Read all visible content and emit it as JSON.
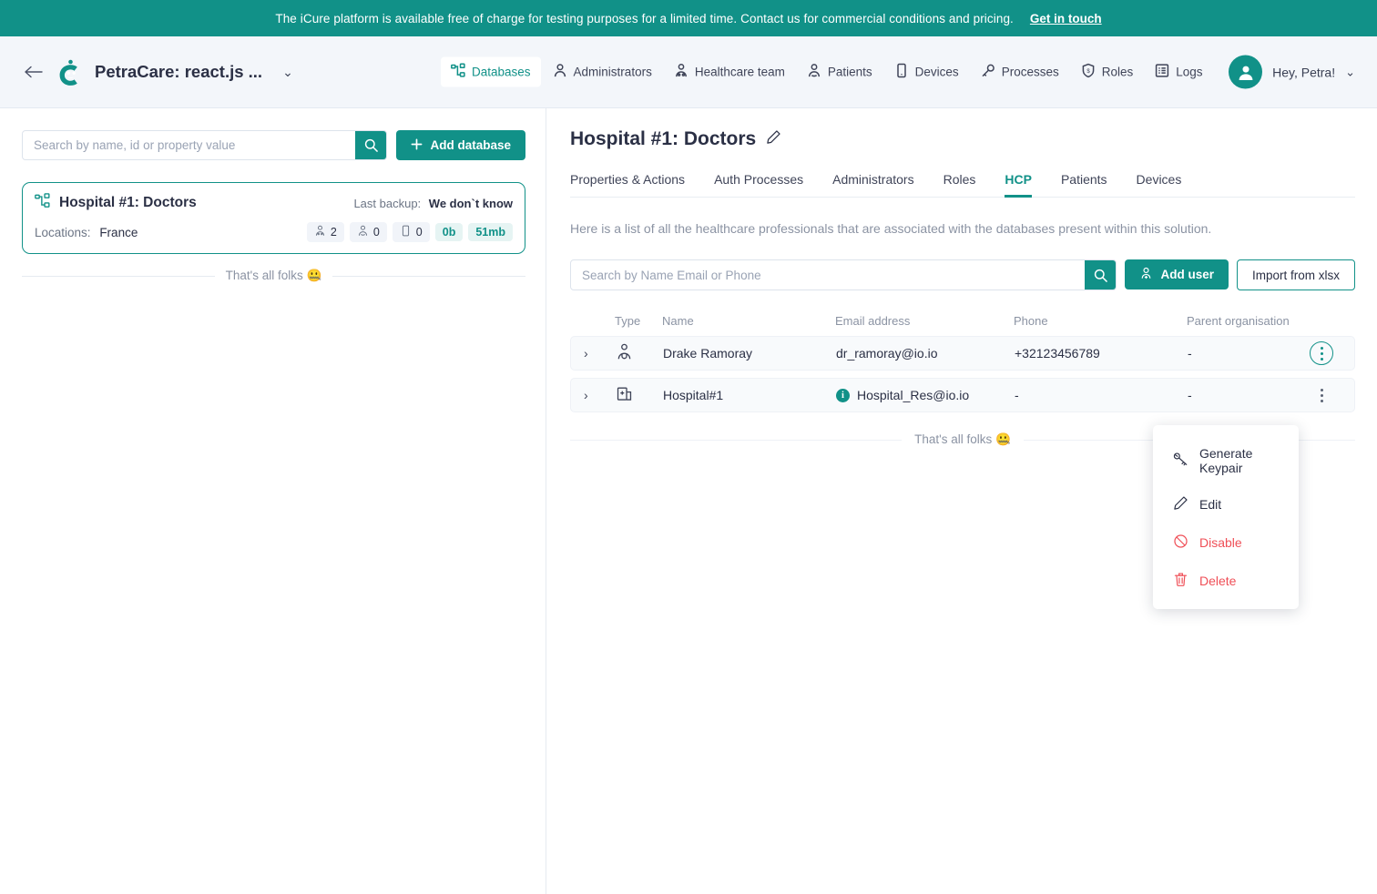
{
  "banner": {
    "text": "The iCure platform is available free of charge for testing purposes for a limited time. Contact us for commercial conditions and pricing.",
    "link_label": "Get in touch",
    "bg_color": "#119188"
  },
  "header": {
    "back_label": "←",
    "brand_title": "PetraCare: react.js ...",
    "brand_caret": "⌄",
    "nav": [
      {
        "label": "Databases",
        "icon": "databases-icon",
        "active": true
      },
      {
        "label": "Administrators",
        "icon": "administrators-icon",
        "active": false
      },
      {
        "label": "Healthcare team",
        "icon": "healthcare-team-icon",
        "active": false
      },
      {
        "label": "Patients",
        "icon": "patients-icon",
        "active": false
      },
      {
        "label": "Devices",
        "icon": "devices-icon",
        "active": false
      },
      {
        "label": "Processes",
        "icon": "processes-icon",
        "active": false
      },
      {
        "label": "Roles",
        "icon": "roles-icon",
        "active": false
      },
      {
        "label": "Logs",
        "icon": "logs-icon",
        "active": false
      }
    ],
    "user": {
      "greeting": "Hey, Petra!",
      "caret": "⌄",
      "avatar_icon": "user-avatar-icon"
    }
  },
  "sidebar": {
    "search": {
      "placeholder": "Search by name, id or property value",
      "value": ""
    },
    "add_database_label": "Add database",
    "database_card": {
      "name": "Hospital #1: Doctors",
      "backup_label": "Last backup:",
      "backup_value": "We don`t know",
      "locations_label": "Locations:",
      "locations_value": "France",
      "badges": [
        {
          "icon": "hcp-icon",
          "value": "2",
          "style": "grey"
        },
        {
          "icon": "patients-icon",
          "value": "0",
          "style": "grey"
        },
        {
          "icon": "device-icon",
          "value": "0",
          "style": "grey"
        },
        {
          "icon": "",
          "value": "0b",
          "style": "teal"
        },
        {
          "icon": "",
          "value": "51mb",
          "style": "teal"
        }
      ]
    },
    "end_of_list": "That's all folks 🤐"
  },
  "main": {
    "title": "Hospital #1: Doctors",
    "edit_icon": "pencil-icon",
    "tabs": [
      {
        "label": "Properties & Actions",
        "active": false
      },
      {
        "label": "Auth Processes",
        "active": false
      },
      {
        "label": "Administrators",
        "active": false
      },
      {
        "label": "Roles",
        "active": false
      },
      {
        "label": "HCP",
        "active": true
      },
      {
        "label": "Patients",
        "active": false
      },
      {
        "label": "Devices",
        "active": false
      }
    ],
    "description": "Here is a list of all the healthcare professionals that are associated with the databases present within this solution.",
    "search": {
      "placeholder": "Search by Name Email or Phone",
      "value": ""
    },
    "add_user_label": "Add user",
    "import_label": "Import from xlsx",
    "table": {
      "columns": [
        "Type",
        "Name",
        "Email address",
        "Phone",
        "Parent organisation"
      ],
      "rows": [
        {
          "expander": "›",
          "type_icon": "doctor-icon",
          "name": "Drake Ramoray",
          "email": "dr_ramoray@io.io",
          "email_badge": false,
          "phone": "+32123456789",
          "parent": "-",
          "menu_open": true
        },
        {
          "expander": "›",
          "type_icon": "hospital-icon",
          "name": "Hospital#1",
          "email": "Hospital_Res@io.io",
          "email_badge": true,
          "phone": "-",
          "parent": "-",
          "menu_open": false
        }
      ]
    },
    "end_of_list": "That's all folks 🤐"
  },
  "context_menu": {
    "items": [
      {
        "label": "Generate Keypair",
        "icon": "keypair-icon",
        "danger": false
      },
      {
        "label": "Edit",
        "icon": "pencil-icon",
        "danger": false
      },
      {
        "label": "Disable",
        "icon": "disable-icon",
        "danger": true
      },
      {
        "label": "Delete",
        "icon": "trash-icon",
        "danger": true
      }
    ]
  },
  "colors": {
    "accent": "#119188",
    "danger": "#ef4f57",
    "header_bg": "#f3f6fa",
    "text": "#2b3045",
    "muted": "#8b93a3"
  }
}
